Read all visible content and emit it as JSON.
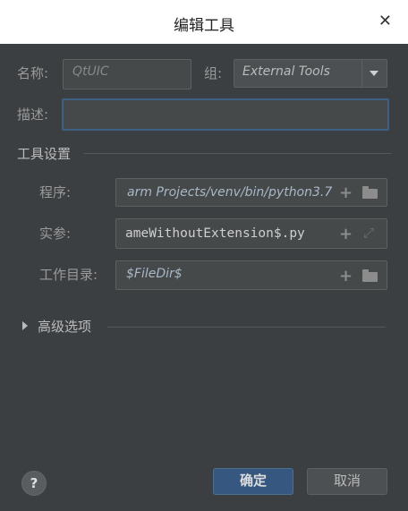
{
  "dialog": {
    "title": "编辑工具",
    "close_icon": "close-icon"
  },
  "form": {
    "name_label": "名称:",
    "name_value": "QtUIC",
    "group_label": "组:",
    "group_value": "External Tools",
    "description_label": "描述:",
    "description_value": ""
  },
  "tool_settings": {
    "section_title": "工具设置",
    "program_label": "程序:",
    "program_value": "arm Projects/venv/bin/python3.7",
    "arguments_label": "实参:",
    "arguments_value": "ameWithoutExtension$.py",
    "workdir_label": "工作目录:",
    "workdir_value": "$FileDir$"
  },
  "advanced": {
    "label": "高级选项"
  },
  "footer": {
    "help_label": "?",
    "ok_label": "确定",
    "cancel_label": "取消"
  },
  "colors": {
    "background": "#3c3f41",
    "accent": "#365880",
    "focus": "#3d6185"
  }
}
